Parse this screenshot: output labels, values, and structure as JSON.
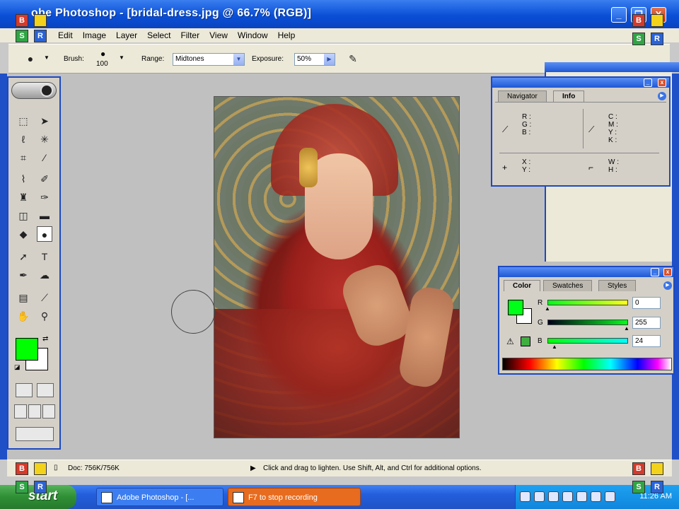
{
  "window": {
    "title": "Adobe Photoshop - [bridal-dress.jpg @ 66.7% (RGB)]",
    "title_visible": "obe Photoshop - [bridal-dress.jpg @ 66.7% (RGB)]",
    "minimize": "_",
    "restore": "❐",
    "close": "X"
  },
  "markers": {
    "b": "B",
    "y": "",
    "s": "S",
    "r": "R"
  },
  "menu": [
    "Edit",
    "Image",
    "Layer",
    "Select",
    "Filter",
    "View",
    "Window",
    "Help"
  ],
  "options": {
    "brush_label": "Brush:",
    "brush_size": "100",
    "range_label": "Range:",
    "range_value": "Midtones",
    "exposure_label": "Exposure:",
    "exposure_value": "50%"
  },
  "palettes": {
    "info": {
      "tabs": [
        "Navigator",
        "Info"
      ],
      "active_tab": "Info",
      "rgb_labels": "R :\nG :\nB :",
      "cmyk_labels": "C :\nM :\nY :\nK :",
      "xy_labels": "X :\nY :",
      "wh_labels": "W :\nH :"
    },
    "color": {
      "tabs": [
        "Color",
        "Swatches",
        "Styles"
      ],
      "active_tab": "Color",
      "channels": [
        {
          "label": "R",
          "value": "0"
        },
        {
          "label": "G",
          "value": "255"
        },
        {
          "label": "B",
          "value": "24"
        }
      ],
      "foreground": "#00ff18"
    }
  },
  "colors": {
    "foreground": "#00ff00",
    "background": "#ffffff",
    "xp_blue": "#0a4fd6"
  },
  "status": {
    "doc": "Doc: 756K/756K",
    "message": "Click and drag to lighten. Use Shift, Alt, and Ctrl for additional options."
  },
  "taskbar": {
    "start": "start",
    "tasks": [
      "Adobe Photoshop - [...",
      "F7 to stop recording"
    ],
    "clock": "11:26 AM"
  }
}
